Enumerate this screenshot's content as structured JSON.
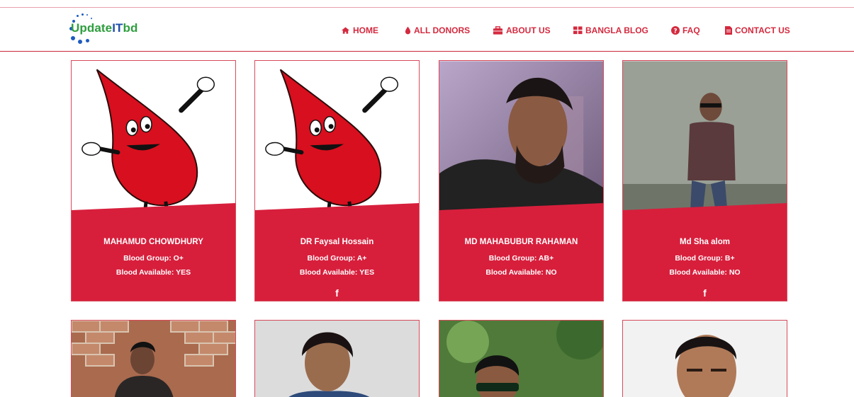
{
  "logo": {
    "part1": "Update",
    "part2": "IT",
    "part3": "bd"
  },
  "nav": [
    {
      "label": "HOME",
      "icon": "home-icon"
    },
    {
      "label": "ALL DONORS",
      "icon": "blood-drop-icon"
    },
    {
      "label": "ABOUT US",
      "icon": "briefcase-icon"
    },
    {
      "label": "BANGLA BLOG",
      "icon": "grid-icon"
    },
    {
      "label": "FAQ",
      "icon": "question-circle-icon"
    },
    {
      "label": "CONTACT US",
      "icon": "document-icon"
    }
  ],
  "donors": [
    {
      "name": "MAHAMUD CHOWDHURY",
      "blood_group": "Blood Group: O+",
      "available": "Blood Available: YES",
      "facebook": "",
      "photo": "blood-drop-mascot"
    },
    {
      "name": "DR Faysal Hossain",
      "blood_group": "Blood Group: A+",
      "available": "Blood Available: YES",
      "facebook": "f",
      "photo": "blood-drop-mascot"
    },
    {
      "name": "MD MAHABUBUR RAHAMAN",
      "blood_group": "Blood Group: AB+",
      "available": "Blood Available: NO",
      "facebook": "",
      "photo": "person-photo"
    },
    {
      "name": "Md Sha alom",
      "blood_group": "Blood Group: B+",
      "available": "Blood Available: NO",
      "facebook": "f",
      "photo": "person-photo"
    }
  ],
  "colors": {
    "accent": "#d71f3c",
    "nav": "#d42a3f",
    "logo_green": "#2e9e3e",
    "logo_blue": "#1e4fa8"
  }
}
